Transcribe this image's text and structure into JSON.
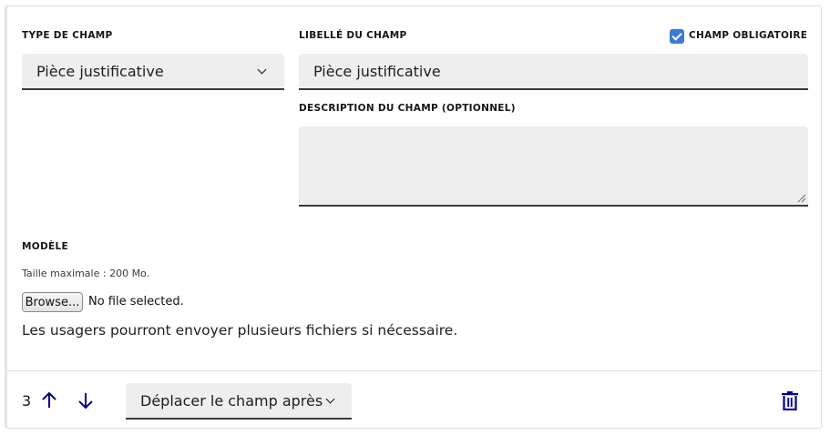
{
  "type_field": {
    "label": "TYPE DE CHAMP",
    "value": "Pièce justificative"
  },
  "libelle_field": {
    "label": "LIBELLÉ DU CHAMP",
    "value": "Pièce justificative"
  },
  "mandatory": {
    "label": "CHAMP OBLIGATOIRE",
    "checked": true
  },
  "description_field": {
    "label": "DESCRIPTION DU CHAMP (OPTIONNEL)",
    "value": ""
  },
  "modele": {
    "label": "MODÈLE",
    "hint": "Taille maximale : 200 Mo.",
    "browse_label": "Browse...",
    "file_status": "No file selected."
  },
  "info_text": "Les usagers pourront envoyer plusieurs fichiers si nécessaire.",
  "footer": {
    "position": "3",
    "move_after_label": "Déplacer le champ après"
  },
  "colors": {
    "accent": "#000091",
    "checkbox": "#3e7bd6",
    "field_bg": "#eeeeee"
  },
  "icons": [
    "arrow-up-icon",
    "arrow-down-icon",
    "trash-icon",
    "chevron-down-icon",
    "check-icon"
  ]
}
